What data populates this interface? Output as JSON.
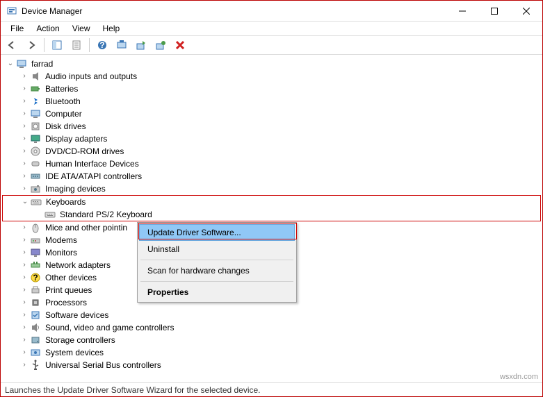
{
  "window": {
    "title": "Device Manager"
  },
  "menu": {
    "file": "File",
    "action": "Action",
    "view": "View",
    "help": "Help"
  },
  "tree": {
    "root": "farrad",
    "items": [
      {
        "label": "Audio inputs and outputs",
        "icon": "audio"
      },
      {
        "label": "Batteries",
        "icon": "battery"
      },
      {
        "label": "Bluetooth",
        "icon": "bluetooth"
      },
      {
        "label": "Computer",
        "icon": "computer"
      },
      {
        "label": "Disk drives",
        "icon": "disk"
      },
      {
        "label": "Display adapters",
        "icon": "display"
      },
      {
        "label": "DVD/CD-ROM drives",
        "icon": "optical"
      },
      {
        "label": "Human Interface Devices",
        "icon": "hid"
      },
      {
        "label": "IDE ATA/ATAPI controllers",
        "icon": "ide"
      },
      {
        "label": "Imaging devices",
        "icon": "imaging"
      },
      {
        "label": "Keyboards",
        "icon": "keyboard",
        "expanded": true,
        "highlight": true,
        "children": [
          {
            "label": "Standard PS/2 Keyboard",
            "icon": "keyboard"
          }
        ]
      },
      {
        "label": "Mice and other pointin",
        "icon": "mouse"
      },
      {
        "label": "Modems",
        "icon": "modem"
      },
      {
        "label": "Monitors",
        "icon": "monitor"
      },
      {
        "label": "Network adapters",
        "icon": "network"
      },
      {
        "label": "Other devices",
        "icon": "other"
      },
      {
        "label": "Print queues",
        "icon": "printer"
      },
      {
        "label": "Processors",
        "icon": "cpu"
      },
      {
        "label": "Software devices",
        "icon": "software"
      },
      {
        "label": "Sound, video and game controllers",
        "icon": "sound"
      },
      {
        "label": "Storage controllers",
        "icon": "storage"
      },
      {
        "label": "System devices",
        "icon": "system"
      },
      {
        "label": "Universal Serial Bus controllers",
        "icon": "usb"
      }
    ]
  },
  "context_menu": {
    "update": "Update Driver Software...",
    "uninstall": "Uninstall",
    "scan": "Scan for hardware changes",
    "properties": "Properties"
  },
  "statusbar": "Launches the Update Driver Software Wizard for the selected device.",
  "watermark": "wsxdn.com"
}
